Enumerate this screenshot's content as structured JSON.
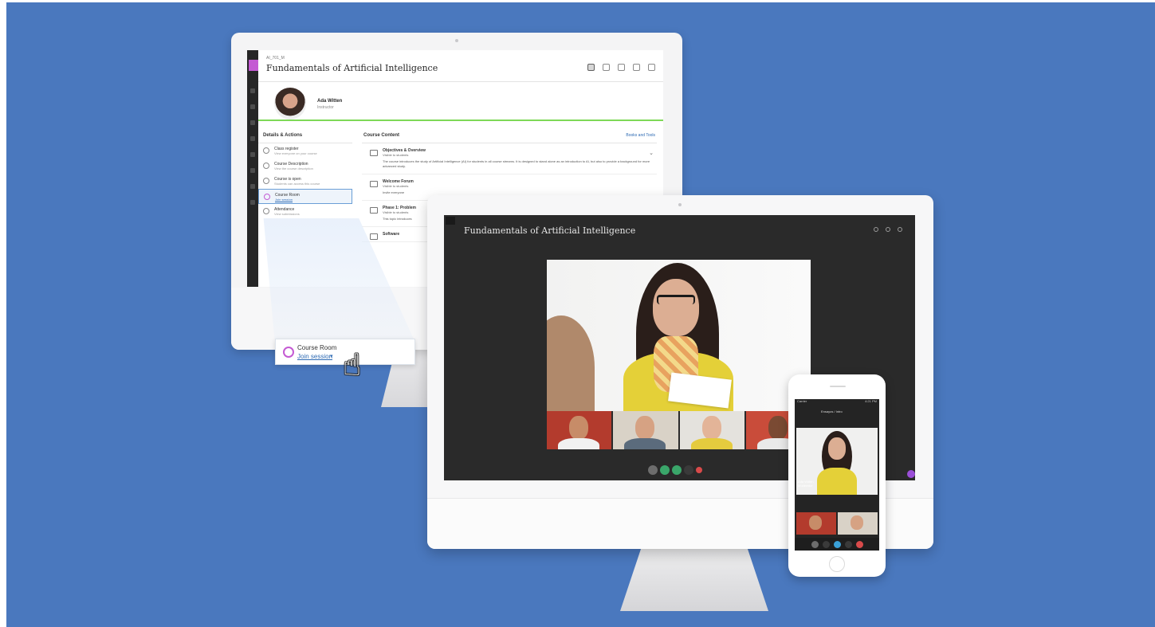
{
  "lms": {
    "course_code": "AI_701_M",
    "course_title": "Fundamentals of Artificial Intelligence",
    "instructor_name": "Ada Witten",
    "instructor_role": "Instructor",
    "details_heading": "Details & Actions",
    "details": [
      {
        "title": "Class register",
        "sub": "View everyone on your course"
      },
      {
        "title": "Course Description",
        "sub": "View the course description"
      },
      {
        "title": "Course is open",
        "sub": "Students can access this course"
      },
      {
        "title": "Course Room",
        "sub": "Join session"
      },
      {
        "title": "Attendance",
        "sub": "View submissions"
      }
    ],
    "content_heading": "Course Content",
    "content_action": "Books and Tools",
    "content_items": [
      {
        "title": "Objectives & Overview",
        "visibility": "Visible to students",
        "desc": "The course introduces the study of Artificial Intelligence (AI) for students in all course streams. It is designed to stand alone as an introduction to AI, but also to provide a background for more advanced study."
      },
      {
        "title": "Welcome Forum",
        "visibility": "Visible to students",
        "desc": "Invite everyone"
      },
      {
        "title": "Phase 1: Problem",
        "visibility": "Visible to students",
        "desc": "This topic introduces"
      },
      {
        "title": "Software",
        "visibility": "",
        "desc": ""
      }
    ]
  },
  "popup": {
    "title": "Course Room",
    "link": "Join session"
  },
  "collab": {
    "title": "Fundamentals of Artificial Intelligence",
    "control_colors": [
      "#6d6d6d",
      "#3aa66a",
      "#3aa66a",
      "#3a3a3a",
      "#d84a4a"
    ]
  },
  "phone": {
    "status_carrier": "Carrier",
    "status_time": "4:21 PM",
    "nav_title": "Ensayos / Intro",
    "speaker": "Ada Witten",
    "speaker_role": "Moderator"
  },
  "colors": {
    "background": "#4a78be",
    "accent_purple": "#c45ad3",
    "accent_green": "#7ed957",
    "link_blue": "#2d6ab3"
  }
}
